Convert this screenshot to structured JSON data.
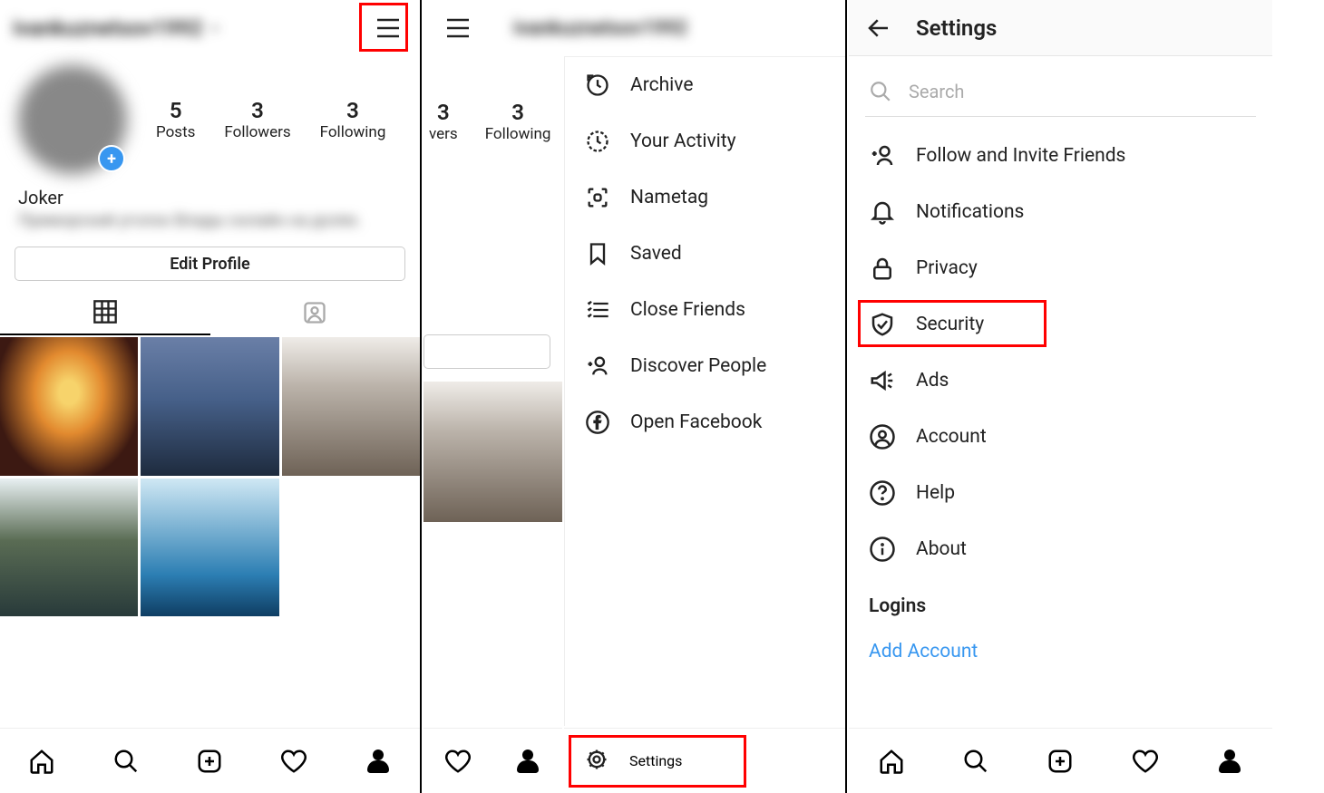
{
  "panel1": {
    "username": "ivankuznetsov1992",
    "stats": {
      "posts": {
        "num": "5",
        "label": "Posts"
      },
      "followers": {
        "num": "3",
        "label": "Followers"
      },
      "following": {
        "num": "3",
        "label": "Following"
      }
    },
    "display_name": "Joker",
    "bio_blur": "Приморский уголок Влады онлайн на долях.",
    "edit_profile": "Edit Profile"
  },
  "panel2": {
    "username": "ivankuznetsov1992",
    "stats_visible": {
      "followers_partial": {
        "num": "3",
        "label": "vers"
      },
      "following": {
        "num": "3",
        "label": "Following"
      }
    },
    "menu": [
      {
        "icon": "archive-icon",
        "label": "Archive"
      },
      {
        "icon": "activity-icon",
        "label": "Your Activity"
      },
      {
        "icon": "nametag-icon",
        "label": "Nametag"
      },
      {
        "icon": "saved-icon",
        "label": "Saved"
      },
      {
        "icon": "close-friends-icon",
        "label": "Close Friends"
      },
      {
        "icon": "discover-people-icon",
        "label": "Discover People"
      },
      {
        "icon": "facebook-icon",
        "label": "Open Facebook"
      }
    ],
    "settings": "Settings"
  },
  "panel3": {
    "title": "Settings",
    "search_placeholder": "Search",
    "items": [
      {
        "icon": "follow-invite-icon",
        "label": "Follow and Invite Friends"
      },
      {
        "icon": "notifications-icon",
        "label": "Notifications"
      },
      {
        "icon": "privacy-icon",
        "label": "Privacy"
      },
      {
        "icon": "security-icon",
        "label": "Security"
      },
      {
        "icon": "ads-icon",
        "label": "Ads"
      },
      {
        "icon": "account-icon",
        "label": "Account"
      },
      {
        "icon": "help-icon",
        "label": "Help"
      },
      {
        "icon": "about-icon",
        "label": "About"
      }
    ],
    "logins_title": "Logins",
    "add_account": "Add Account"
  }
}
